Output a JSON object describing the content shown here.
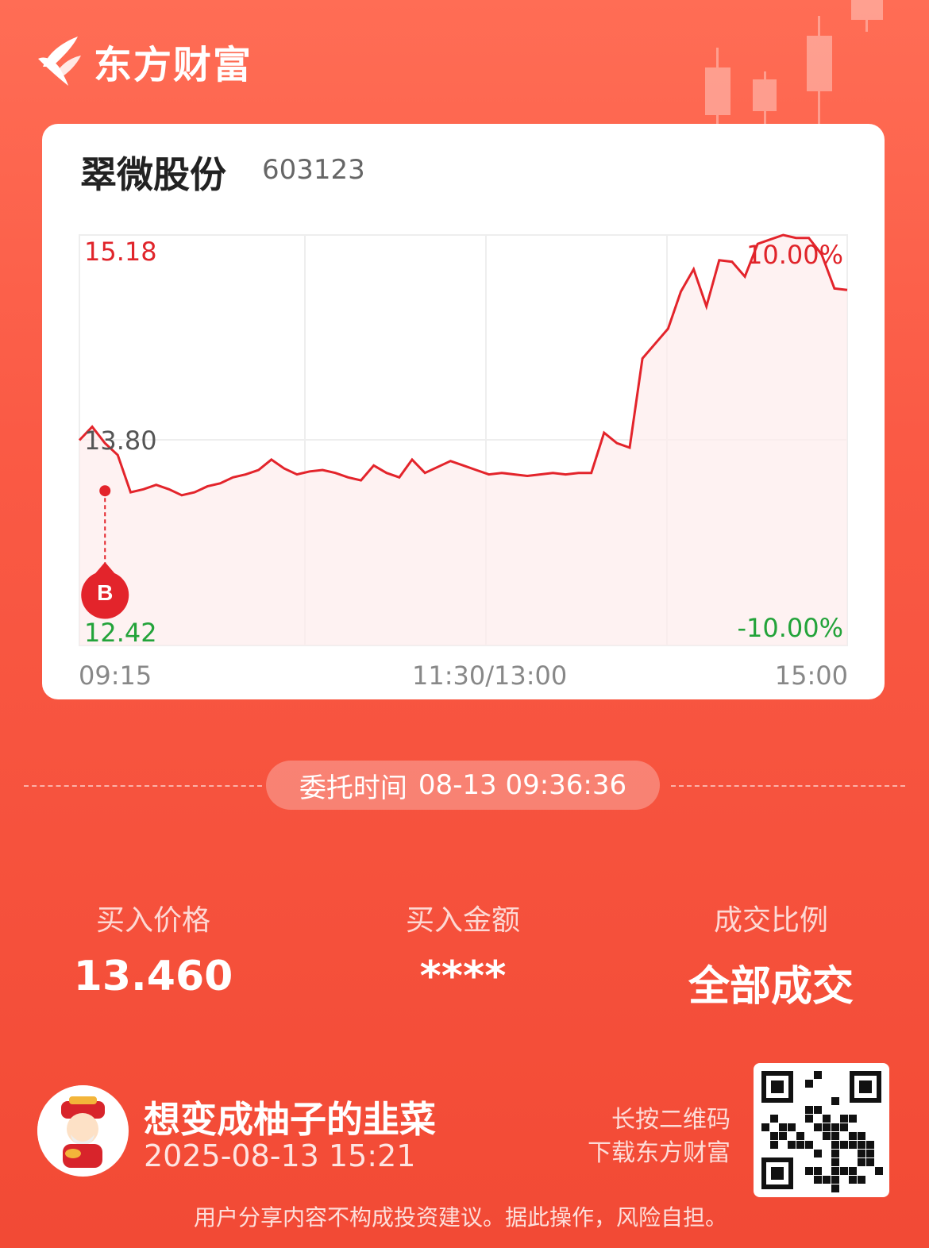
{
  "brand": {
    "name": "东方财富"
  },
  "stock": {
    "name": "翠微股份",
    "code": "603123"
  },
  "chart_data": {
    "type": "line",
    "price_high": "15.18",
    "price_base": "13.80",
    "price_low": "12.42",
    "pct_high": "10.00%",
    "pct_low": "-10.00%",
    "x_ticks": [
      "09:15",
      "11:30/13:00",
      "15:00"
    ],
    "ylim": [
      12.42,
      15.18
    ],
    "x": [
      0,
      4,
      8,
      12,
      16,
      20,
      24,
      28,
      32,
      36,
      40,
      44,
      48,
      52,
      56,
      60,
      64,
      68,
      72,
      76,
      80,
      84,
      88,
      92,
      96,
      100,
      104,
      108,
      112,
      116,
      120,
      124,
      128,
      132,
      136,
      140,
      144,
      148,
      152,
      156,
      160,
      164,
      168,
      172,
      176,
      180,
      184,
      188,
      192,
      196,
      200,
      204,
      208,
      212,
      216,
      220,
      224,
      228,
      232,
      236,
      240
    ],
    "values": [
      13.8,
      13.89,
      13.78,
      13.7,
      13.45,
      13.47,
      13.5,
      13.47,
      13.43,
      13.45,
      13.49,
      13.51,
      13.55,
      13.57,
      13.6,
      13.67,
      13.61,
      13.57,
      13.59,
      13.6,
      13.58,
      13.55,
      13.53,
      13.63,
      13.58,
      13.55,
      13.67,
      13.58,
      13.62,
      13.66,
      13.63,
      13.6,
      13.57,
      13.58,
      13.57,
      13.56,
      13.57,
      13.58,
      13.57,
      13.58,
      13.58,
      13.85,
      13.78,
      13.75,
      14.35,
      14.45,
      14.55,
      14.8,
      14.95,
      14.7,
      15.01,
      15.0,
      14.9,
      15.12,
      15.15,
      15.18,
      15.16,
      15.16,
      15.05,
      14.82,
      14.81
    ],
    "buy_marker": {
      "x": 8,
      "price": 13.46,
      "label": "B"
    }
  },
  "order": {
    "time_label": "委托时间",
    "time_value": "08-13 09:36:36"
  },
  "stats": [
    {
      "label": "买入价格",
      "value": "13.460"
    },
    {
      "label": "买入金额",
      "value": "****"
    },
    {
      "label": "成交比例",
      "value": "全部成交"
    }
  ],
  "user": {
    "name": "想变成柚子的韭菜",
    "share_time": "2025-08-13 15:21"
  },
  "qr_hint": {
    "line1": "长按二维码",
    "line2": "下载东方财富"
  },
  "disclaimer": "用户分享内容不构成投资建议。据此操作，风险自担。",
  "colors": {
    "up": "#e0242a",
    "down": "#23a33a",
    "background": "#f24a35"
  }
}
